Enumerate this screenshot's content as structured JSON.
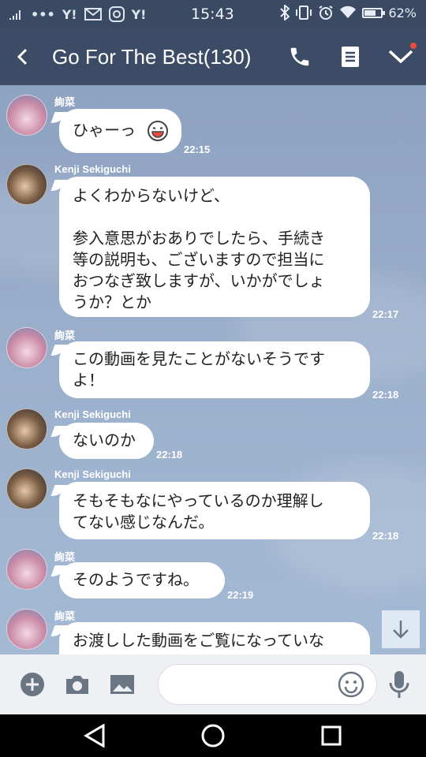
{
  "status_bar": {
    "time": "15:43",
    "battery_text": "62%",
    "battery_level": 0.62,
    "left_icons": [
      "signal-icon",
      "more-icon",
      "yahoo-icon",
      "mail-icon",
      "instagram-icon",
      "yahoo-icon"
    ],
    "right_icons": [
      "bluetooth-icon",
      "vibrate-icon",
      "alarm-icon",
      "wifi-icon",
      "battery-icon"
    ]
  },
  "header": {
    "title": "Go For The Best(130)",
    "icons": [
      "back-icon",
      "phone-icon",
      "notes-icon",
      "chevron-down-icon"
    ],
    "bg_color": "#3d4c66"
  },
  "messages": [
    {
      "sender": "絢菜",
      "text": "ひゃーっ",
      "time": "22:15",
      "avatar": "ayana-avatar"
    },
    {
      "sender": "Kenji Sekiguchi",
      "text": "よくわからないけど、\n\n参入意思がおありでしたら、手続き\n等の説明も、ございますので担当に\nおつなぎ致しますが、いかがでしょ\nうか？とか",
      "time": "22:17",
      "avatar": "kenji-avatar"
    },
    {
      "sender": "絢菜",
      "text": "この動画を見たことがないそうです\nよ！",
      "time": "22:18",
      "avatar": "ayana-avatar"
    },
    {
      "sender": "Kenji Sekiguchi",
      "text": "ないのか",
      "time": "22:18",
      "avatar": "kenji-avatar"
    },
    {
      "sender": "Kenji Sekiguchi",
      "text": "そもそもなにやっているのか理解し\nてない感じなんだ。",
      "time": "22:18",
      "avatar": "kenji-avatar"
    },
    {
      "sender": "絢菜",
      "text": "そのようですね。",
      "time": "22:19",
      "avatar": "ayana-avatar"
    },
    {
      "sender": "絢菜",
      "text": "お渡しした動画をご覧になっていな",
      "time": "",
      "avatar": "ayana-avatar"
    }
  ],
  "input_bar": {
    "value": "",
    "placeholder": "",
    "icons": [
      "plus-icon",
      "camera-icon",
      "image-icon",
      "emoji-icon",
      "microphone-icon"
    ]
  },
  "nav_bar": {
    "icons": [
      "back-triangle-icon",
      "home-circle-icon",
      "recents-square-icon"
    ]
  },
  "colors": {
    "chat_bg": "#9aafcb",
    "bubble": "#ffffff",
    "accent_dot": "#e74c3c"
  }
}
